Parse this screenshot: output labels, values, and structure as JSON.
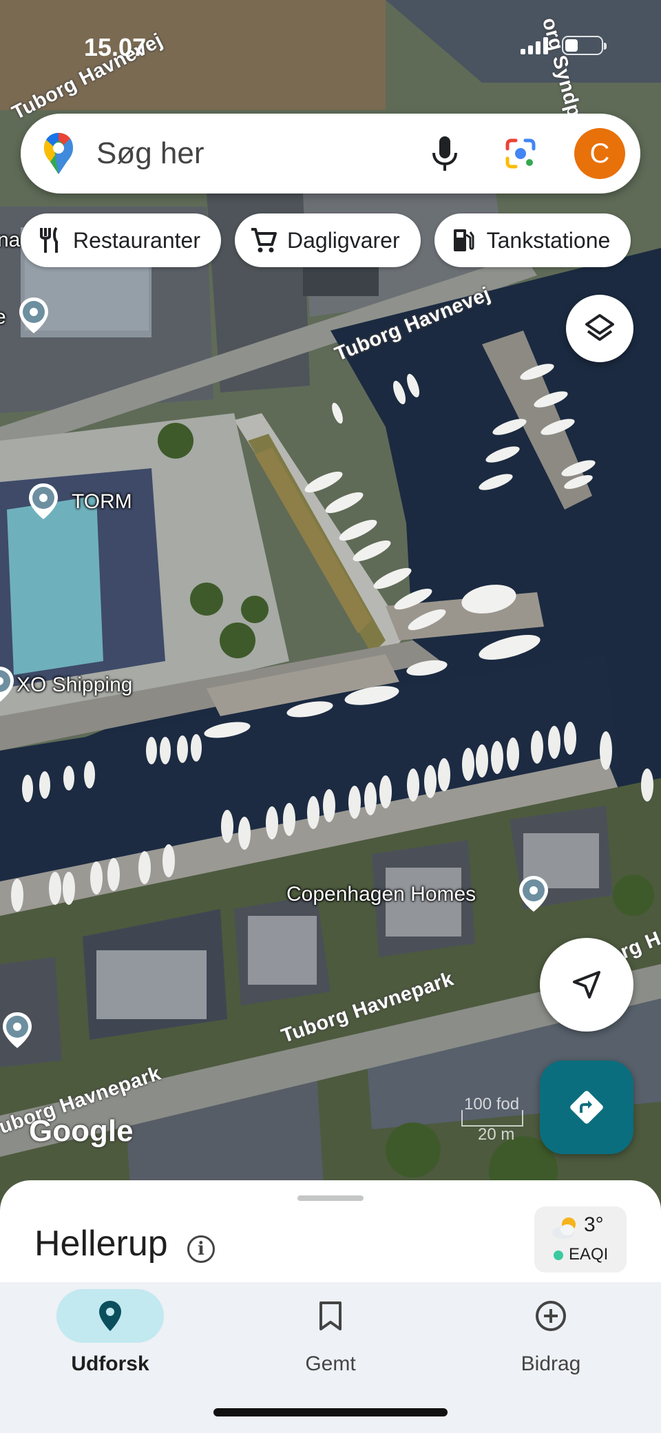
{
  "status_bar": {
    "time": "15.07"
  },
  "search": {
    "placeholder": "Søg her",
    "avatar_letter": "C"
  },
  "chips": [
    {
      "label": "Restauranter",
      "icon": "fork-knife-icon"
    },
    {
      "label": "Dagligvarer",
      "icon": "cart-icon"
    },
    {
      "label": "Tankstatione",
      "icon": "gas-pump-icon"
    }
  ],
  "map": {
    "place_labels": {
      "torm": "TORM",
      "xo_shipping": "XO Shipping",
      "copenhagen_homes": "Copenhagen Homes",
      "left_edge_na": "na",
      "left_edge_e": "e"
    },
    "street_labels": {
      "havnevej_top": "Tuborg Havnevej",
      "havnevej_center": "Tuborg Havnevej",
      "syndpark": "org Syndpark",
      "havnepark_center": "Tuborg Havnepark",
      "havnepark_left": "uborg Havnepark",
      "right_edge": "org H"
    },
    "watermark": "Google",
    "scale": {
      "feet": "100 fod",
      "meters": "20 m"
    }
  },
  "sheet": {
    "title": "Hellerup",
    "weather": {
      "temp": "3°",
      "aqi": "EAQI",
      "icon": "partly-cloudy-icon"
    }
  },
  "nav": {
    "items": [
      {
        "label": "Udforsk",
        "icon": "location-pin-icon",
        "active": true
      },
      {
        "label": "Gemt",
        "icon": "bookmark-icon",
        "active": false
      },
      {
        "label": "Bidrag",
        "icon": "plus-circle-icon",
        "active": false
      }
    ]
  },
  "colors": {
    "accent_teal": "#0b6e7e",
    "avatar_orange": "#e8710a",
    "nav_active": "#c2e8f0",
    "water": "#1b2a40"
  }
}
